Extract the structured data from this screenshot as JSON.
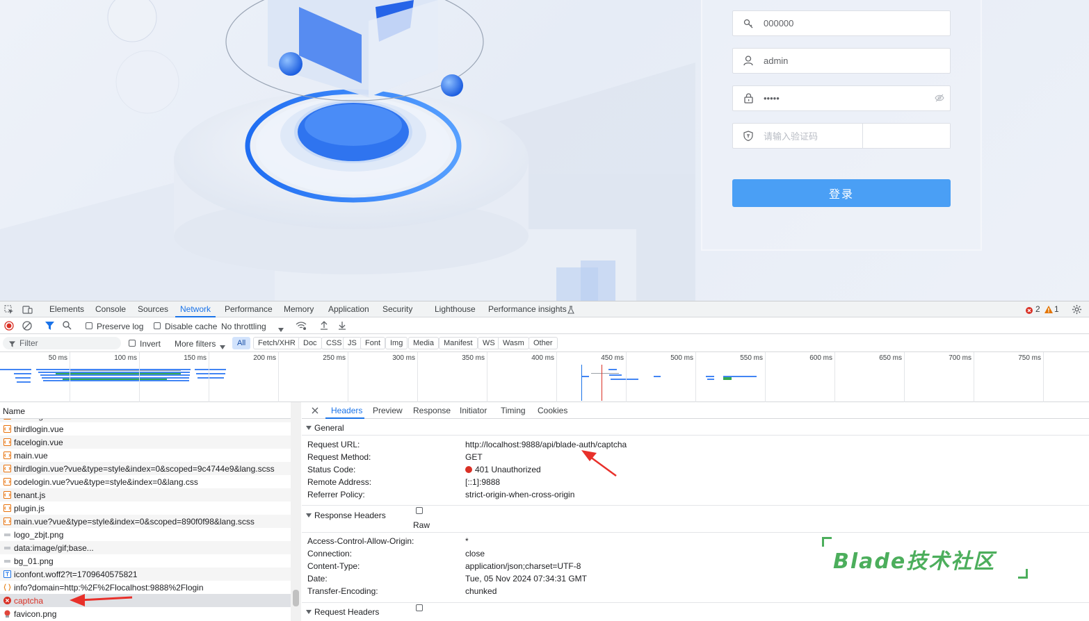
{
  "login": {
    "tenant_value": "000000",
    "username_value": "admin",
    "password_value": "•••••",
    "captcha_placeholder": "请输入验证码",
    "login_label": "登录"
  },
  "devtools": {
    "tabs": [
      "Elements",
      "Console",
      "Sources",
      "Network",
      "Performance",
      "Memory",
      "Application",
      "Security",
      "Lighthouse",
      "Performance insights"
    ],
    "active_tab": "Network",
    "error_count": "2",
    "warning_count": "1",
    "toolbar": {
      "preserve_log": "Preserve log",
      "disable_cache": "Disable cache",
      "throttling": "No throttling"
    },
    "filterbar": {
      "filter_placeholder": "Filter",
      "invert": "Invert",
      "more_filters": "More filters",
      "chips": [
        "All",
        "Fetch/XHR",
        "Doc",
        "CSS",
        "JS",
        "Font",
        "Img",
        "Media",
        "Manifest",
        "WS",
        "Wasm",
        "Other"
      ]
    },
    "timeline_ticks": [
      "50 ms",
      "100 ms",
      "150 ms",
      "200 ms",
      "250 ms",
      "300 ms",
      "350 ms",
      "400 ms",
      "450 ms",
      "500 ms",
      "550 ms",
      "600 ms",
      "650 ms",
      "700 ms",
      "750 ms"
    ],
    "request_list": {
      "header": "Name",
      "rows": [
        {
          "name": "codelogin.vue",
          "type": "script"
        },
        {
          "name": "thirdlogin.vue",
          "type": "script"
        },
        {
          "name": "facelogin.vue",
          "type": "script"
        },
        {
          "name": "main.vue",
          "type": "script"
        },
        {
          "name": "thirdlogin.vue?vue&type=style&index=0&scoped=9c4744e9&lang.scss",
          "type": "script"
        },
        {
          "name": "codelogin.vue?vue&type=style&index=0&lang.css",
          "type": "script"
        },
        {
          "name": "tenant.js",
          "type": "script"
        },
        {
          "name": "plugin.js",
          "type": "script"
        },
        {
          "name": "main.vue?vue&type=style&index=0&scoped=890f0f98&lang.scss",
          "type": "script"
        },
        {
          "name": "logo_zbjt.png",
          "type": "image"
        },
        {
          "name": "data:image/gif;base...",
          "type": "image"
        },
        {
          "name": "bg_01.png",
          "type": "image"
        },
        {
          "name": "iconfont.woff2?t=1709640575821",
          "type": "font"
        },
        {
          "name": "info?domain=http:%2F%2Flocalhost:9888%2Flogin",
          "type": "xhr"
        },
        {
          "name": "captcha",
          "type": "error"
        },
        {
          "name": "favicon.png",
          "type": "favicon"
        }
      ]
    },
    "detail": {
      "tabs": [
        "Headers",
        "Preview",
        "Response",
        "Initiator",
        "Timing",
        "Cookies"
      ],
      "active_tab": "Headers",
      "general_title": "General",
      "general": [
        {
          "key": "Request URL:",
          "value": "http://localhost:9888/api/blade-auth/captcha"
        },
        {
          "key": "Request Method:",
          "value": "GET"
        },
        {
          "key": "Status Code:",
          "value": "401 Unauthorized"
        },
        {
          "key": "Remote Address:",
          "value": "[::1]:9888"
        },
        {
          "key": "Referrer Policy:",
          "value": "strict-origin-when-cross-origin"
        }
      ],
      "response_headers_title": "Response Headers",
      "raw_label": "Raw",
      "response_headers": [
        {
          "key": "Access-Control-Allow-Origin:",
          "value": "*"
        },
        {
          "key": "Connection:",
          "value": "close"
        },
        {
          "key": "Content-Type:",
          "value": "application/json;charset=UTF-8"
        },
        {
          "key": "Date:",
          "value": "Tue, 05 Nov 2024 07:34:31 GMT"
        },
        {
          "key": "Transfer-Encoding:",
          "value": "chunked"
        }
      ],
      "request_headers_title": "Request Headers"
    }
  },
  "watermark": "Blade技术社区",
  "colors": {
    "accent": "#1a73e8",
    "login_button": "#4a9ff5",
    "error": "#d93025",
    "annotation_arrow": "#e8302a",
    "watermark": "#4cae5c"
  }
}
